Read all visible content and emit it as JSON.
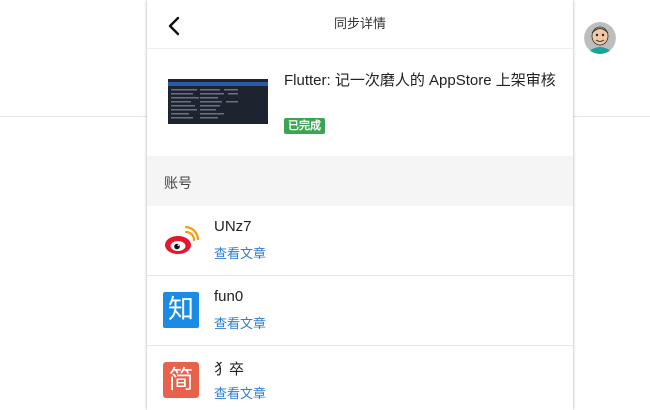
{
  "header": {
    "title": "同步详情",
    "back_icon": "chevron-left-icon"
  },
  "article": {
    "title": "Flutter: 记一次磨人的 AppStore 上架审核",
    "status": "已完成",
    "status_color": "#3ba553"
  },
  "section": {
    "title": "账号"
  },
  "accounts": [
    {
      "platform_icon": "weibo-icon",
      "name": "UNz7",
      "link": "查看文章"
    },
    {
      "platform_icon": "zhihu-icon",
      "name": "fun0",
      "logo_text": "知",
      "link": "查看文章"
    },
    {
      "platform_icon": "jianshu-icon",
      "name": "犭卒",
      "logo_text": "简",
      "link": "查看文章"
    }
  ],
  "colors": {
    "link": "#2a7fd4",
    "zhihu": "#1a8ce6",
    "jianshu": "#e8624b",
    "weibo": "#e6162d"
  }
}
